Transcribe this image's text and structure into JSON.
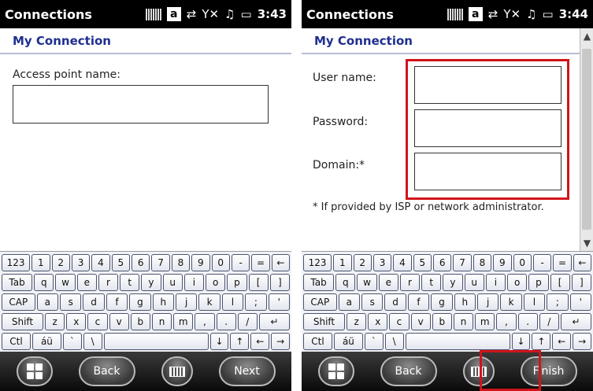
{
  "left": {
    "status": {
      "title": "Connections",
      "time": "3:43"
    },
    "header": "My Connection",
    "access_point_label": "Access point name:",
    "access_point_value": "",
    "softkeys": {
      "left": "Back",
      "right": "Next"
    }
  },
  "right": {
    "status": {
      "title": "Connections",
      "time": "3:44"
    },
    "header": "My Connection",
    "user_label": "User name:",
    "password_label": "Password:",
    "domain_label": "Domain:*",
    "footnote": "* If provided by ISP or network administrator.",
    "softkeys": {
      "left": "Back",
      "right": "Finish"
    }
  },
  "status_icons": {
    "a_label": "a",
    "sync": "⇄",
    "signal": "Y✕",
    "speaker": "♫",
    "battery": "▭"
  },
  "keyboard": {
    "row1": [
      "123",
      "1",
      "2",
      "3",
      "4",
      "5",
      "6",
      "7",
      "8",
      "9",
      "0",
      "-",
      "=",
      "←"
    ],
    "row2": [
      "Tab",
      "q",
      "w",
      "e",
      "r",
      "t",
      "y",
      "u",
      "i",
      "o",
      "p",
      "[",
      "]"
    ],
    "row3": [
      "CAP",
      "a",
      "s",
      "d",
      "f",
      "g",
      "h",
      "j",
      "k",
      "l",
      ";",
      "'"
    ],
    "row4": [
      "Shift",
      "z",
      "x",
      "c",
      "v",
      "b",
      "n",
      "m",
      ",",
      ".",
      "/",
      "↵"
    ],
    "row5": [
      "Ctl",
      "áü",
      "`",
      "\\",
      "",
      "↓",
      "↑",
      "←",
      "→"
    ]
  },
  "colors": {
    "accent": "#1f2f8f",
    "highlight": "#d0141a"
  }
}
